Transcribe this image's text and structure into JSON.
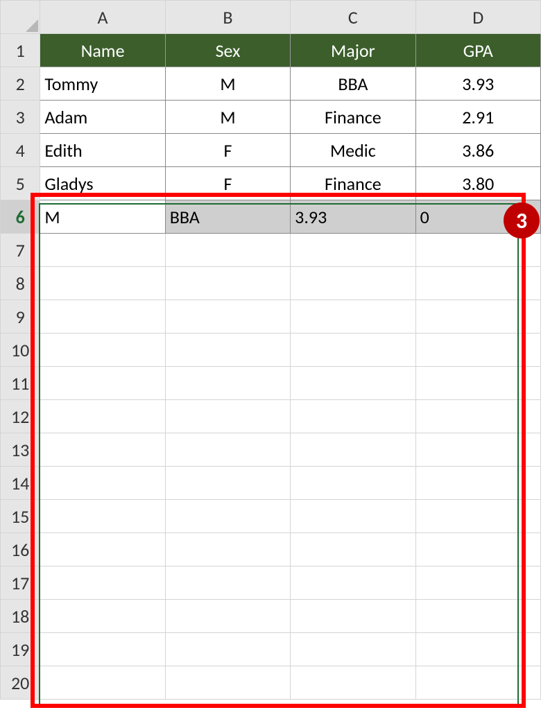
{
  "columns": [
    "A",
    "B",
    "C",
    "D"
  ],
  "row_numbers": [
    1,
    2,
    3,
    4,
    5,
    6,
    7,
    8,
    9,
    10,
    11,
    12,
    13,
    14,
    15,
    16,
    17,
    18,
    19,
    20
  ],
  "headers": {
    "A": "Name",
    "B": "Sex",
    "C": "Major",
    "D": "GPA"
  },
  "rows": [
    {
      "A": "Tommy",
      "B": "M",
      "C": "BBA",
      "D": "3.93"
    },
    {
      "A": "Adam",
      "B": "M",
      "C": "Finance",
      "D": "2.91"
    },
    {
      "A": "Edith",
      "B": "F",
      "C": "Medic",
      "D": "3.86"
    },
    {
      "A": "Gladys",
      "B": "F",
      "C": "Finance",
      "D": "3.80"
    }
  ],
  "selected_row": {
    "A": "M",
    "B": "BBA",
    "C": "3.93",
    "D": "0"
  },
  "badge": "3"
}
